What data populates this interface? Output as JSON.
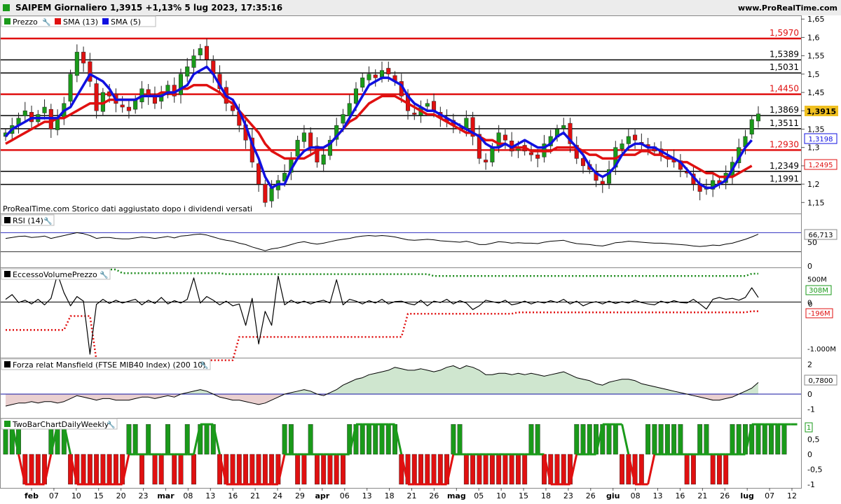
{
  "header": {
    "title": "SAIPEM Giornaliero 1,3915 +1,13% 5 lug 2023, 17:35:16",
    "site": "www.ProRealTime.com"
  },
  "price_panel": {
    "legend": [
      "Prezzo",
      "SMA (13)",
      "SMA (5)"
    ],
    "note": "ProRealTime.com  Storico dati aggiustato dopo i dividendi versati",
    "current_tag": "1,3915",
    "sma5_tag": "1,3198",
    "sma13_tag": "1,2495"
  },
  "rsi_panel": {
    "legend": "RSI (14)",
    "tag": "66,713"
  },
  "volume_panel": {
    "legend": "EccessoVolumePrezzo",
    "tag_upper": "308M",
    "tag_lower": "-196M",
    "tag_zero": "0"
  },
  "mansfield_panel": {
    "legend": "Forza relat Mansfield (FTSE MIB40 Index) (200 10)",
    "tag": "0,7800"
  },
  "twobar_panel": {
    "legend": "TwoBarChartDailyWeekly",
    "tag": "1"
  },
  "colors": {
    "up": "#1a9a1a",
    "down": "#e01010",
    "sma5": "#1010e0",
    "sma13": "#e01010",
    "level_red": "#e01010",
    "level_black": "#000000",
    "current": "#f0c020"
  },
  "chart_data": [
    {
      "type": "candlestick",
      "title": "SAIPEM Giornaliero",
      "ylim": [
        1.12,
        1.66
      ],
      "y_ticks": [
        "1,65",
        "1,6",
        "1,55",
        "1,5",
        "1,45",
        "1,4",
        "1,35",
        "1,3",
        "1,25",
        "1,2",
        "1,15"
      ],
      "x_labels": [
        "feb",
        "07",
        "10",
        "15",
        "20",
        "23",
        "mar",
        "08",
        "13",
        "16",
        "21",
        "24",
        "29",
        "apr",
        "06",
        "13",
        "18",
        "21",
        "26",
        "mag",
        "05",
        "10",
        "15",
        "18",
        "23",
        "26",
        "giu",
        "08",
        "13",
        "16",
        "21",
        "26",
        "lug",
        "07",
        "12"
      ],
      "horizontal_levels": [
        {
          "value": 1.597,
          "label": "1,5970",
          "color": "red"
        },
        {
          "value": 1.5389,
          "label": "1,5389",
          "color": "black"
        },
        {
          "value": 1.5031,
          "label": "1,5031",
          "color": "black"
        },
        {
          "value": 1.445,
          "label": "1,4450",
          "color": "red"
        },
        {
          "value": 1.3869,
          "label": "1,3869",
          "color": "black"
        },
        {
          "value": 1.3511,
          "label": "1,3511",
          "color": "black"
        },
        {
          "value": 1.293,
          "label": "1,2930",
          "color": "red"
        },
        {
          "value": 1.2349,
          "label": "1,2349",
          "color": "black"
        },
        {
          "value": 1.1991,
          "label": "1,1991",
          "color": "black"
        }
      ],
      "close": [
        1.34,
        1.36,
        1.38,
        1.4,
        1.37,
        1.39,
        1.41,
        1.35,
        1.38,
        1.42,
        1.5,
        1.56,
        1.53,
        1.48,
        1.4,
        1.45,
        1.44,
        1.42,
        1.41,
        1.4,
        1.43,
        1.46,
        1.44,
        1.42,
        1.45,
        1.47,
        1.44,
        1.5,
        1.52,
        1.55,
        1.57,
        1.54,
        1.5,
        1.46,
        1.42,
        1.4,
        1.36,
        1.32,
        1.26,
        1.2,
        1.15,
        1.19,
        1.21,
        1.23,
        1.27,
        1.32,
        1.34,
        1.3,
        1.26,
        1.28,
        1.32,
        1.36,
        1.39,
        1.42,
        1.46,
        1.49,
        1.5,
        1.49,
        1.51,
        1.5,
        1.48,
        1.44,
        1.4,
        1.39,
        1.41,
        1.42,
        1.4,
        1.38,
        1.37,
        1.36,
        1.35,
        1.38,
        1.33,
        1.27,
        1.26,
        1.3,
        1.34,
        1.32,
        1.29,
        1.3,
        1.29,
        1.28,
        1.27,
        1.31,
        1.33,
        1.35,
        1.36,
        1.31,
        1.27,
        1.25,
        1.24,
        1.21,
        1.2,
        1.24,
        1.3,
        1.31,
        1.33,
        1.32,
        1.31,
        1.3,
        1.29,
        1.28,
        1.27,
        1.26,
        1.24,
        1.23,
        1.2,
        1.18,
        1.19,
        1.21,
        1.2,
        1.23,
        1.26,
        1.3,
        1.33,
        1.376,
        1.3915
      ],
      "sma5": [
        1.33,
        1.35,
        1.36,
        1.37,
        1.38,
        1.38,
        1.38,
        1.38,
        1.38,
        1.4,
        1.41,
        1.44,
        1.47,
        1.5,
        1.49,
        1.48,
        1.46,
        1.43,
        1.43,
        1.43,
        1.43,
        1.44,
        1.44,
        1.44,
        1.44,
        1.45,
        1.45,
        1.46,
        1.47,
        1.5,
        1.51,
        1.52,
        1.5,
        1.47,
        1.44,
        1.43,
        1.4,
        1.36,
        1.31,
        1.27,
        1.22,
        1.19,
        1.2,
        1.2,
        1.24,
        1.27,
        1.29,
        1.3,
        1.3,
        1.3,
        1.31,
        1.33,
        1.35,
        1.38,
        1.41,
        1.44,
        1.47,
        1.48,
        1.49,
        1.49,
        1.48,
        1.47,
        1.44,
        1.42,
        1.41,
        1.4,
        1.4,
        1.39,
        1.38,
        1.37,
        1.36,
        1.35,
        1.34,
        1.33,
        1.31,
        1.3,
        1.3,
        1.31,
        1.3,
        1.31,
        1.32,
        1.31,
        1.3,
        1.3,
        1.31,
        1.33,
        1.34,
        1.32,
        1.3,
        1.28,
        1.25,
        1.23,
        1.22,
        1.23,
        1.25,
        1.28,
        1.3,
        1.31,
        1.31,
        1.3,
        1.3,
        1.29,
        1.28,
        1.27,
        1.26,
        1.24,
        1.22,
        1.2,
        1.19,
        1.19,
        1.2,
        1.21,
        1.24,
        1.27,
        1.3,
        1.32
      ],
      "sma13": [
        1.31,
        1.32,
        1.33,
        1.34,
        1.35,
        1.36,
        1.37,
        1.37,
        1.38,
        1.38,
        1.39,
        1.4,
        1.41,
        1.42,
        1.42,
        1.42,
        1.43,
        1.43,
        1.43,
        1.43,
        1.43,
        1.44,
        1.44,
        1.44,
        1.45,
        1.45,
        1.45,
        1.46,
        1.46,
        1.47,
        1.47,
        1.47,
        1.46,
        1.45,
        1.43,
        1.42,
        1.4,
        1.38,
        1.36,
        1.34,
        1.31,
        1.29,
        1.28,
        1.27,
        1.27,
        1.27,
        1.27,
        1.28,
        1.29,
        1.3,
        1.31,
        1.33,
        1.35,
        1.37,
        1.38,
        1.4,
        1.42,
        1.43,
        1.44,
        1.44,
        1.44,
        1.43,
        1.42,
        1.41,
        1.4,
        1.39,
        1.39,
        1.38,
        1.37,
        1.36,
        1.35,
        1.34,
        1.34,
        1.33,
        1.32,
        1.32,
        1.31,
        1.31,
        1.3,
        1.3,
        1.3,
        1.29,
        1.29,
        1.29,
        1.29,
        1.3,
        1.3,
        1.3,
        1.3,
        1.29,
        1.28,
        1.28,
        1.27,
        1.27,
        1.27,
        1.28,
        1.28,
        1.28,
        1.29,
        1.29,
        1.28,
        1.28,
        1.27,
        1.27,
        1.26,
        1.26,
        1.25,
        1.24,
        1.23,
        1.23,
        1.22,
        1.22,
        1.22,
        1.23,
        1.24,
        1.25
      ]
    },
    {
      "type": "line",
      "title": "RSI (14)",
      "ylim": [
        0,
        100
      ],
      "y_ticks": [
        "50",
        "0"
      ],
      "values": [
        58,
        60,
        62,
        63,
        60,
        61,
        63,
        58,
        61,
        64,
        67,
        70,
        68,
        64,
        58,
        60,
        60,
        58,
        57,
        57,
        59,
        61,
        60,
        58,
        60,
        62,
        59,
        63,
        64,
        66,
        67,
        65,
        61,
        57,
        54,
        52,
        48,
        45,
        40,
        36,
        32,
        36,
        38,
        41,
        45,
        49,
        51,
        48,
        46,
        48,
        51,
        54,
        56,
        58,
        61,
        63,
        64,
        63,
        64,
        63,
        61,
        58,
        55,
        54,
        55,
        56,
        55,
        53,
        52,
        51,
        50,
        52,
        49,
        45,
        45,
        48,
        51,
        50,
        48,
        49,
        48,
        48,
        47,
        50,
        52,
        53,
        54,
        50,
        47,
        46,
        45,
        43,
        42,
        45,
        49,
        50,
        52,
        51,
        50,
        49,
        48,
        48,
        47,
        46,
        45,
        44,
        42,
        41,
        42,
        44,
        43,
        46,
        48,
        52,
        56,
        61,
        66.7
      ]
    },
    {
      "type": "line",
      "title": "EccessoVolumePrezzo",
      "y_ticks": [
        "500M",
        "0",
        "-1.000M"
      ],
      "values": [
        60,
        160,
        -10,
        40,
        -40,
        60,
        -60,
        80,
        600,
        200,
        -80,
        120,
        20,
        -1300,
        -50,
        60,
        -30,
        40,
        -20,
        20,
        60,
        -60,
        40,
        -30,
        100,
        -40,
        30,
        -20,
        60,
        520,
        -20,
        120,
        40,
        -60,
        20,
        -80,
        -40,
        -500,
        80,
        -900,
        -200,
        -500,
        560,
        -60,
        40,
        -30,
        20,
        -40,
        10,
        40,
        -20,
        480,
        -60,
        60,
        20,
        -40,
        30,
        -20,
        60,
        -40,
        10,
        20,
        -30,
        -60,
        40,
        -80,
        20,
        -10,
        60,
        -40,
        30,
        -20,
        -160,
        -80,
        40,
        10,
        -20,
        40,
        -60,
        -30,
        20,
        -40,
        10,
        -20,
        30,
        -10,
        60,
        -40,
        20,
        -80,
        -20,
        10,
        -40,
        20,
        -30,
        10,
        -20,
        40,
        -10,
        -40,
        -60,
        20,
        -20,
        30,
        -10,
        -20,
        60,
        -40,
        -150,
        60,
        100,
        60,
        80,
        40,
        100,
        308,
        100
      ],
      "upper_band": 500,
      "lower_band": -196
    },
    {
      "type": "area",
      "title": "Forza relat Mansfield (FTSE MIB40 Index) (200 10)",
      "y_ticks": [
        "2",
        "1",
        "0",
        "-1"
      ],
      "values": [
        -0.8,
        -0.7,
        -0.6,
        -0.6,
        -0.5,
        -0.6,
        -0.5,
        -0.5,
        -0.6,
        -0.5,
        -0.3,
        -0.1,
        -0.2,
        -0.3,
        -0.4,
        -0.3,
        -0.3,
        -0.4,
        -0.4,
        -0.4,
        -0.3,
        -0.2,
        -0.2,
        -0.3,
        -0.2,
        -0.1,
        -0.2,
        0.0,
        0.1,
        0.2,
        0.3,
        0.2,
        0.0,
        -0.2,
        -0.3,
        -0.4,
        -0.4,
        -0.5,
        -0.6,
        -0.7,
        -0.6,
        -0.4,
        -0.2,
        0.0,
        0.1,
        0.2,
        0.3,
        0.2,
        0.0,
        -0.1,
        0.1,
        0.3,
        0.6,
        0.8,
        1.0,
        1.1,
        1.3,
        1.4,
        1.5,
        1.6,
        1.8,
        1.7,
        1.6,
        1.6,
        1.7,
        1.6,
        1.5,
        1.6,
        1.8,
        1.9,
        1.7,
        1.9,
        1.8,
        1.6,
        1.3,
        1.3,
        1.4,
        1.4,
        1.3,
        1.4,
        1.3,
        1.4,
        1.3,
        1.2,
        1.3,
        1.4,
        1.5,
        1.3,
        1.1,
        1.0,
        0.9,
        0.7,
        0.6,
        0.8,
        0.9,
        1.0,
        1.0,
        0.9,
        0.7,
        0.6,
        0.5,
        0.4,
        0.3,
        0.2,
        0.1,
        0.0,
        -0.1,
        -0.2,
        -0.3,
        -0.4,
        -0.4,
        -0.3,
        -0.2,
        0.0,
        0.2,
        0.4,
        0.78
      ]
    },
    {
      "type": "bar",
      "title": "TwoBarChartDailyWeekly",
      "ylim": [
        -1,
        1
      ],
      "y_ticks": [
        "1",
        "0,5",
        "0",
        "-0,5",
        "-1"
      ],
      "values": [
        1,
        1,
        1,
        -1,
        -1,
        -1,
        -1,
        1,
        1,
        1,
        -1,
        -1,
        -1,
        -1,
        -1,
        -1,
        -1,
        -1,
        -1,
        1,
        1,
        -1,
        1,
        -1,
        -1,
        1,
        -1,
        -1,
        1,
        -1,
        1,
        1,
        1,
        -1,
        -1,
        -1,
        -1,
        -1,
        -1,
        -1,
        -1,
        -1,
        -1,
        1,
        1,
        -1,
        -1,
        1,
        -1,
        -1,
        -1,
        -1,
        -1,
        1,
        1,
        1,
        1,
        1,
        1,
        1,
        1,
        -1,
        -1,
        -1,
        -1,
        -1,
        -1,
        -1,
        -1,
        1,
        1,
        -1,
        -1,
        -1,
        -1,
        -1,
        -1,
        -1,
        -1,
        -1,
        -1,
        1,
        1,
        -1,
        -1,
        -1,
        -1,
        -1,
        1,
        1,
        1,
        1,
        1,
        1,
        1,
        -1,
        -1,
        -1,
        -1,
        1,
        1,
        1,
        1,
        1,
        1,
        -1,
        -1,
        1,
        1,
        -1,
        -1,
        -1,
        1,
        1,
        1,
        1,
        1,
        1,
        1,
        1,
        1
      ],
      "signal_line": [
        1,
        1,
        0,
        -1,
        -1,
        -1,
        -1,
        0,
        1,
        1,
        0,
        -1,
        -1,
        -1,
        -1,
        -1,
        -1,
        -1,
        -1,
        0,
        0,
        0,
        0,
        0,
        0,
        0,
        0,
        0,
        0,
        0,
        1,
        1,
        1,
        0,
        -1,
        -1,
        -1,
        -1,
        -1,
        -1,
        -1,
        -1,
        -1,
        0,
        0,
        0,
        0,
        0,
        0,
        0,
        0,
        0,
        0,
        0,
        1,
        1,
        1,
        1,
        1,
        1,
        1,
        0,
        -1,
        -1,
        -1,
        -1,
        -1,
        -1,
        -1,
        0,
        0,
        0,
        0,
        0,
        0,
        0,
        0,
        0,
        0,
        0,
        0,
        0,
        0,
        0,
        -1,
        -1,
        -1,
        -1,
        0,
        0,
        0,
        0,
        1,
        1,
        1,
        1,
        0,
        -1,
        -1,
        -1,
        0,
        0,
        0,
        0,
        0,
        0,
        0,
        0,
        0,
        0,
        0,
        0,
        0,
        0,
        0,
        1,
        1,
        1,
        1,
        1,
        1,
        1,
        1
      ]
    }
  ]
}
